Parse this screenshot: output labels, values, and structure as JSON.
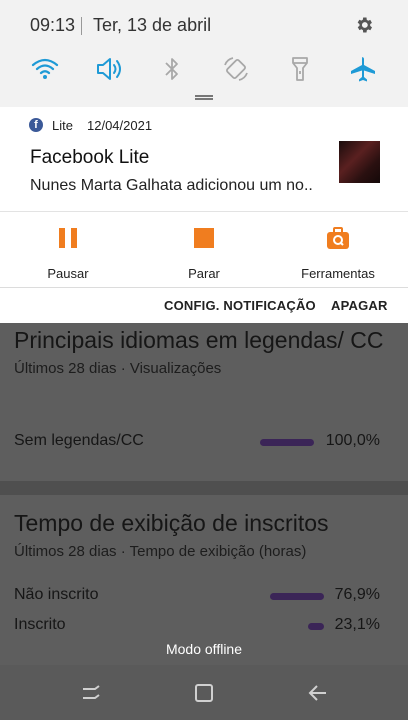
{
  "status_bar": {
    "time": "09:13",
    "date": "Ter, 13 de abril"
  },
  "quick_settings": [
    {
      "name": "wifi",
      "active": true
    },
    {
      "name": "sound",
      "active": true
    },
    {
      "name": "bluetooth",
      "active": false
    },
    {
      "name": "auto-rotate",
      "active": false
    },
    {
      "name": "flashlight",
      "active": false
    },
    {
      "name": "airplane-mode",
      "active": true
    }
  ],
  "notification": {
    "app": "Lite",
    "date": "12/04/2021",
    "title": "Facebook Lite",
    "text": "Nunes Marta Galhata adicionou um no.."
  },
  "media_actions": {
    "pause": "Pausar",
    "stop": "Parar",
    "tools": "Ferramentas"
  },
  "footer": {
    "settings": "CONFIG. NOTIFICAÇÃO",
    "clear": "APAGAR"
  },
  "background": {
    "subtitles": {
      "title": "Principais idiomas em legendas/ CC",
      "subtitle": "Últimos 28 dias · Visualizações",
      "rows": [
        {
          "label": "Sem legendas/CC",
          "value": "100,0%",
          "fraction": 1.0
        }
      ]
    },
    "subscribers": {
      "title": "Tempo de exibição de inscritos",
      "subtitle": "Últimos 28 dias · Tempo de exibição (horas)",
      "rows": [
        {
          "label": "Não inscrito",
          "value": "76,9%",
          "fraction": 0.769
        },
        {
          "label": "Inscrito",
          "value": "23,1%",
          "fraction": 0.231
        }
      ]
    }
  },
  "offline_label": "Modo offline",
  "colors": {
    "accent_blue": "#1e9ad6",
    "accent_orange": "#f07d1f",
    "bar": "#3b2557"
  }
}
